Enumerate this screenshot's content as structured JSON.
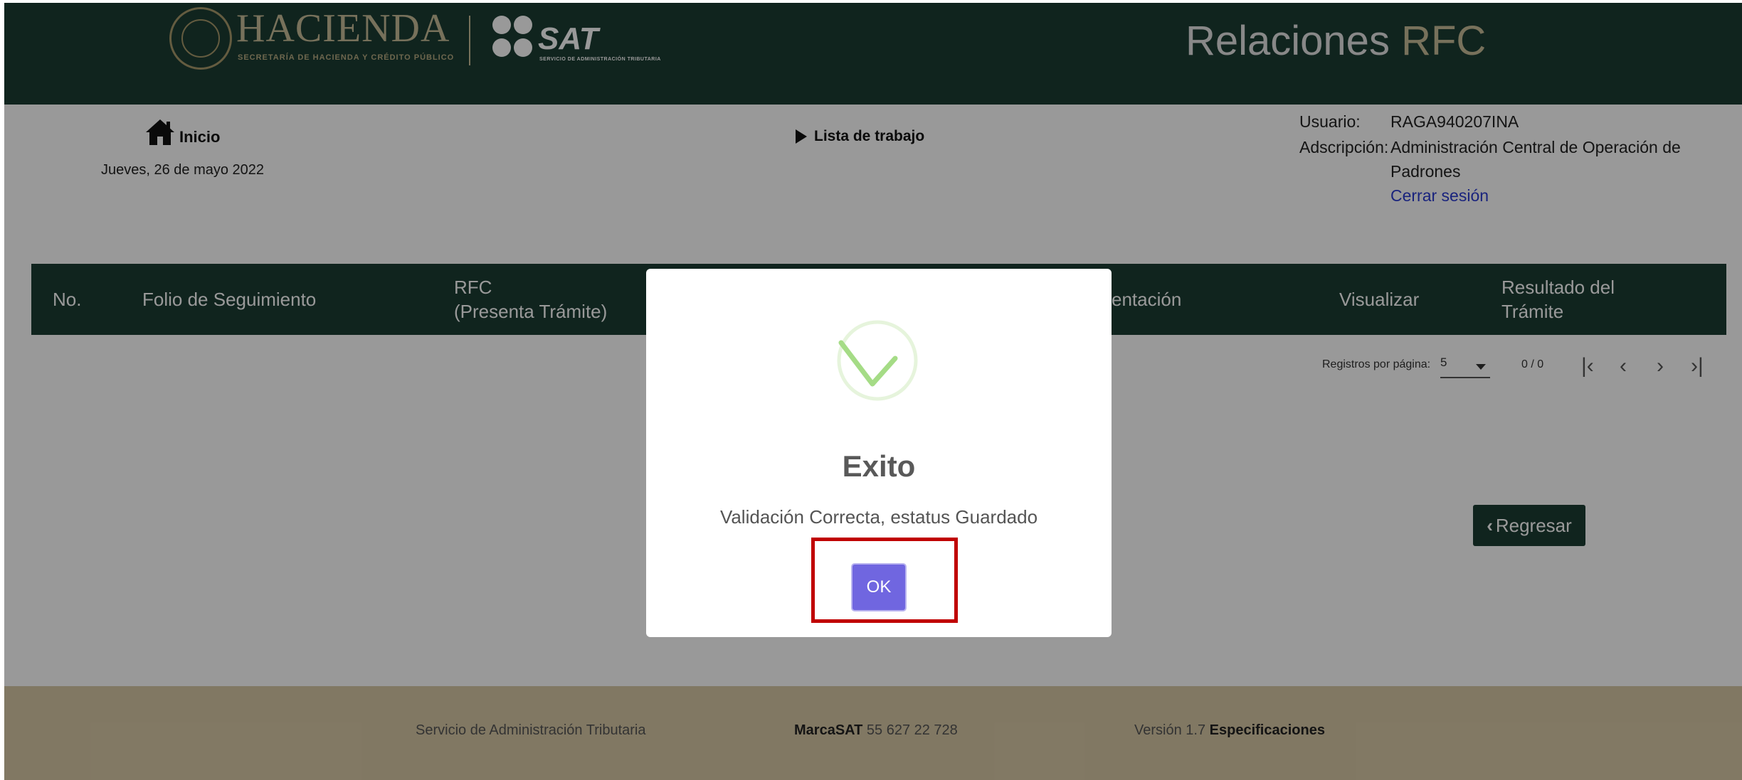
{
  "header": {
    "brand": "HACIENDA",
    "brand_sub": "SECRETARÍA DE HACIENDA Y CRÉDITO PÚBLICO",
    "sat": "SAT",
    "sat_sub": "SERVICIO DE ADMINISTRACIÓN TRIBUTARIA",
    "app_title_1": "Relaciones",
    "app_title_2": "RFC"
  },
  "nav": {
    "inicio": "Inicio",
    "date": "Jueves, 26 de mayo 2022",
    "lista": "Lista de trabajo"
  },
  "user": {
    "usuario_label": "Usuario:",
    "usuario_value": "RAGA940207INA",
    "adscripcion_label": "Adscripción:",
    "adscripcion_line1": "Administración Central de Operación de",
    "adscripcion_line2": "Padrones",
    "logout": "Cerrar sesión"
  },
  "table": {
    "headers": [
      "No.",
      "Folio de Seguimiento",
      "RFC",
      "(Presenta Trámite)",
      "entación",
      "Visualizar",
      "Resultado del",
      "Trámite"
    ]
  },
  "pager": {
    "label": "Registros por página:",
    "value": "5",
    "range": "0 / 0"
  },
  "buttons": {
    "regresar": "Regresar"
  },
  "footer": {
    "org": "Servicio de Administración Tributaria",
    "marca_bold": "MarcaSAT",
    "marca_phone": "55 627 22 728",
    "version": "Versión 1.7",
    "spec": "Especificaciones"
  },
  "modal": {
    "title": "Exito",
    "message": "Validación Correcta, estatus Guardado",
    "ok": "OK"
  },
  "colors": {
    "header": "#1b3c33",
    "gold": "#c7bd98",
    "footer": "#d8c9a6",
    "ok_button": "#7066e0",
    "highlight": "#c00000"
  }
}
